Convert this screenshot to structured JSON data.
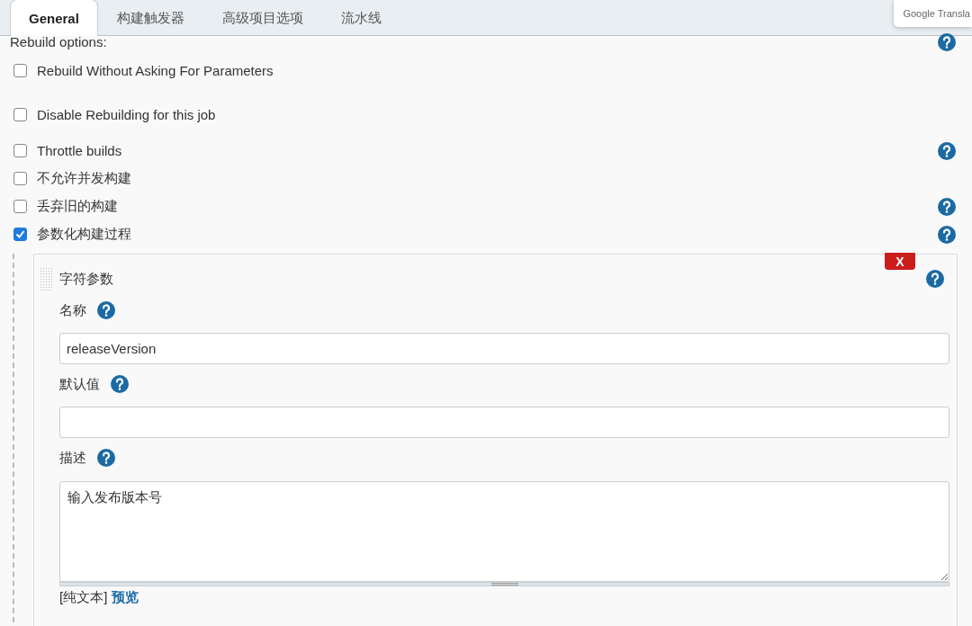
{
  "tabs": [
    {
      "label": "General",
      "selected": true
    },
    {
      "label": "构建触发器",
      "selected": false
    },
    {
      "label": "高级项目选项",
      "selected": false
    },
    {
      "label": "流水线",
      "selected": false
    }
  ],
  "translate_popup": {
    "text": "Google Transla"
  },
  "rebuild_options": {
    "label": "Rebuild options:",
    "help": true,
    "items": [
      {
        "label": "Rebuild Without Asking For Parameters",
        "checked": false,
        "help": false
      },
      {
        "label": "Disable Rebuilding for this job",
        "checked": false,
        "help": false
      }
    ]
  },
  "options": [
    {
      "label": "Throttle builds",
      "checked": false,
      "help": true
    },
    {
      "label": "不允许并发构建",
      "checked": false,
      "help": false
    },
    {
      "label": "丢弃旧的构建",
      "checked": false,
      "help": true
    },
    {
      "label": "参数化构建过程",
      "checked": true,
      "help": true
    }
  ],
  "parameter": {
    "title": "字符参数",
    "delete_label": "X",
    "help": true,
    "fields": [
      {
        "kind": "input",
        "label": "名称",
        "help": true,
        "value": "releaseVersion"
      },
      {
        "kind": "input",
        "label": "默认值",
        "help": true
      },
      {
        "kind": "textarea",
        "label": "描述",
        "help": true,
        "value": "输入发布版本号"
      }
    ],
    "format_note": "[纯文本]",
    "preview_link": "预览"
  }
}
